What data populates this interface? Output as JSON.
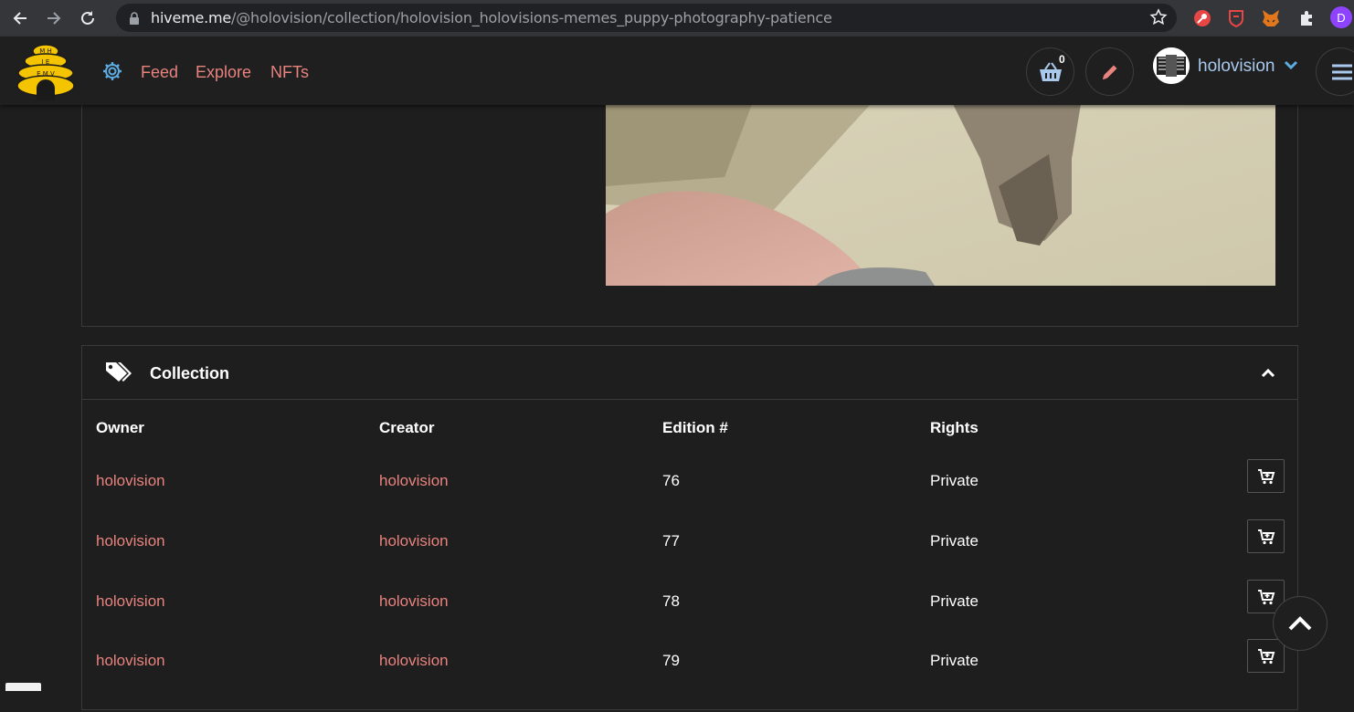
{
  "browser": {
    "url_host": "hiveme.me",
    "url_path": "/@holovision/collection/holovision_holovisions-memes_puppy-photography-patience",
    "profile_initial": "D"
  },
  "header": {
    "nav": [
      "Feed",
      "Explore",
      "NFTs"
    ],
    "cart_count": "0",
    "username": "holovision",
    "logo_letters": "MHIEME"
  },
  "collection": {
    "title": "Collection",
    "columns": [
      "Owner",
      "Creator",
      "Edition #",
      "Rights"
    ],
    "rows": [
      {
        "owner": "holovision",
        "creator": "holovision",
        "edition": "76",
        "rights": "Private"
      },
      {
        "owner": "holovision",
        "creator": "holovision",
        "edition": "77",
        "rights": "Private"
      },
      {
        "owner": "holovision",
        "creator": "holovision",
        "edition": "78",
        "rights": "Private"
      },
      {
        "owner": "holovision",
        "creator": "holovision",
        "edition": "79",
        "rights": "Private"
      }
    ]
  },
  "colors": {
    "accent_link": "#e8837e",
    "accent_blue": "#5dade2",
    "background": "#1e1e1e"
  }
}
